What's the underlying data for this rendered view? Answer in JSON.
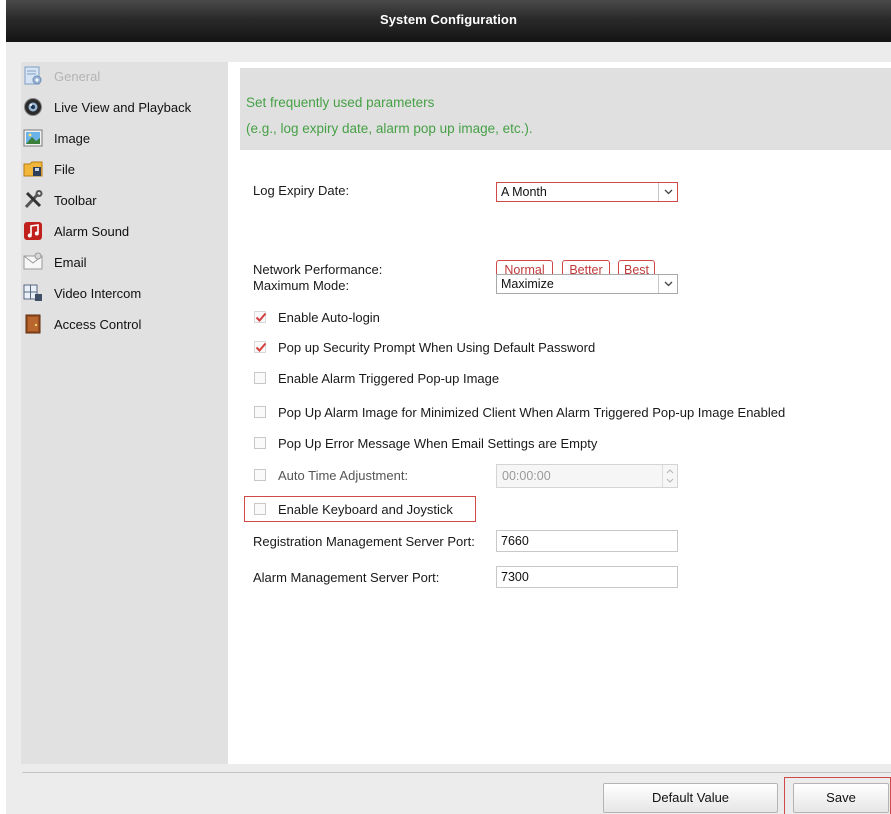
{
  "window": {
    "title": "System Configuration"
  },
  "sidebar": {
    "items": [
      {
        "label": "General",
        "icon": "general-settings-icon",
        "active": true
      },
      {
        "label": "Live View and Playback",
        "icon": "camera-lens-icon"
      },
      {
        "label": "Image",
        "icon": "image-icon"
      },
      {
        "label": "File",
        "icon": "folder-icon"
      },
      {
        "label": "Toolbar",
        "icon": "tools-icon"
      },
      {
        "label": "Alarm Sound",
        "icon": "music-note-icon"
      },
      {
        "label": "Email",
        "icon": "envelope-icon"
      },
      {
        "label": "Video Intercom",
        "icon": "intercom-icon"
      },
      {
        "label": "Access Control",
        "icon": "door-icon"
      }
    ]
  },
  "banner": {
    "line1": "Set frequently used parameters",
    "line2": "(e.g., log expiry date, alarm pop up image, etc.)."
  },
  "form": {
    "log_expiry": {
      "label": "Log Expiry Date:",
      "value": "A Month"
    },
    "network_performance": {
      "label": "Network Performance:",
      "options": [
        "Normal",
        "Better",
        "Best"
      ]
    },
    "maximum_mode": {
      "label": "Maximum Mode:",
      "value": "Maximize"
    },
    "checkboxes": [
      {
        "label": "Enable Auto-login",
        "checked": true
      },
      {
        "label": "Pop up Security Prompt When Using Default Password",
        "checked": true
      },
      {
        "label": "Enable Alarm Triggered Pop-up Image",
        "checked": false
      },
      {
        "label": "Pop Up Alarm Image for Minimized Client When Alarm Triggered Pop-up Image Enabled",
        "checked": false
      },
      {
        "label": "Pop Up Error Message When Email Settings are Empty",
        "checked": false
      },
      {
        "label": "Auto Time Adjustment:",
        "checked": false
      },
      {
        "label": "Enable Keyboard and Joystick",
        "checked": false
      }
    ],
    "auto_time_value": "00:00:00",
    "registration_port": {
      "label": "Registration Management Server Port:",
      "value": "7660"
    },
    "alarm_port": {
      "label": "Alarm Management Server Port:",
      "value": "7300"
    }
  },
  "footer": {
    "default_label": "Default Value",
    "save_label": "Save"
  },
  "colors": {
    "accent_red": "#d04848",
    "banner_text": "#46a046",
    "titlebar": "#1e1e1e"
  }
}
